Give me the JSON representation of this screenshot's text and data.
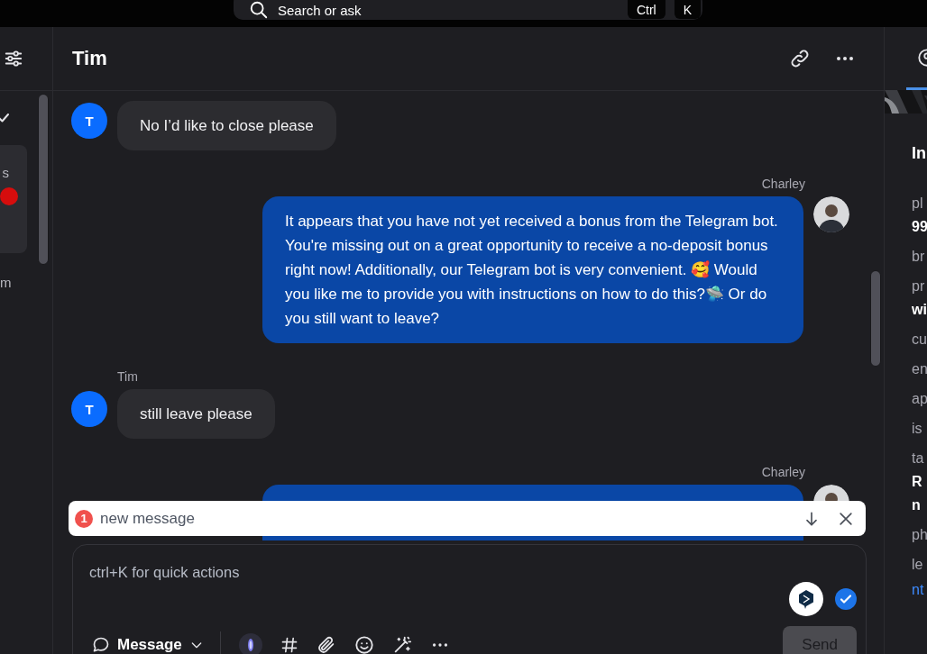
{
  "search": {
    "placeholder": "Search or ask",
    "keys": [
      "Ctrl",
      "K"
    ]
  },
  "sidebar": {
    "checked": true,
    "card": {
      "label": "s",
      "unread": true
    },
    "footer": "m"
  },
  "conversation": {
    "title": "Tim",
    "messages": [
      {
        "kind": "incoming",
        "avatar": "T",
        "text": "No I’d like to close please"
      },
      {
        "kind": "outgoing",
        "author": "Charley",
        "text": "It appears that you have not yet received a bonus from the Telegram bot. You're missing out on a great opportunity to receive a no-deposit bonus right now! Additionally, our Telegram bot is very convenient. 🥰 Would you like me to provide you with instructions on how to do this?🛸 Or do you still want to leave?"
      },
      {
        "kind": "incoming",
        "author": "Tim",
        "avatar": "T",
        "text": "still leave please"
      },
      {
        "kind": "outgoing",
        "author": "Charley"
      }
    ]
  },
  "banner": {
    "count": "1",
    "text": "new message"
  },
  "composer": {
    "placeholder": "ctrl+K for quick actions",
    "checked": true,
    "mode": "Message",
    "send": {
      "label": "Send",
      "disabled": true
    }
  },
  "details": {
    "heading": "In",
    "rows": [
      {
        "kind": "key",
        "text": "pl"
      },
      {
        "kind": "value",
        "text": "99"
      },
      {
        "kind": "key",
        "text": "br"
      },
      {
        "kind": "key",
        "text": "pr"
      },
      {
        "kind": "value",
        "text": "wi"
      },
      {
        "kind": "key",
        "text": "cu"
      },
      {
        "kind": "key",
        "text": "en"
      },
      {
        "kind": "key",
        "text": "ap"
      },
      {
        "kind": "key",
        "text": "is"
      },
      {
        "kind": "key",
        "text": "ta"
      },
      {
        "kind": "value",
        "text": "R"
      },
      {
        "kind": "value",
        "text": "n"
      },
      {
        "kind": "key",
        "text": "ph"
      },
      {
        "kind": "key",
        "text": "le"
      },
      {
        "kind": "link",
        "text": "nt"
      }
    ]
  }
}
